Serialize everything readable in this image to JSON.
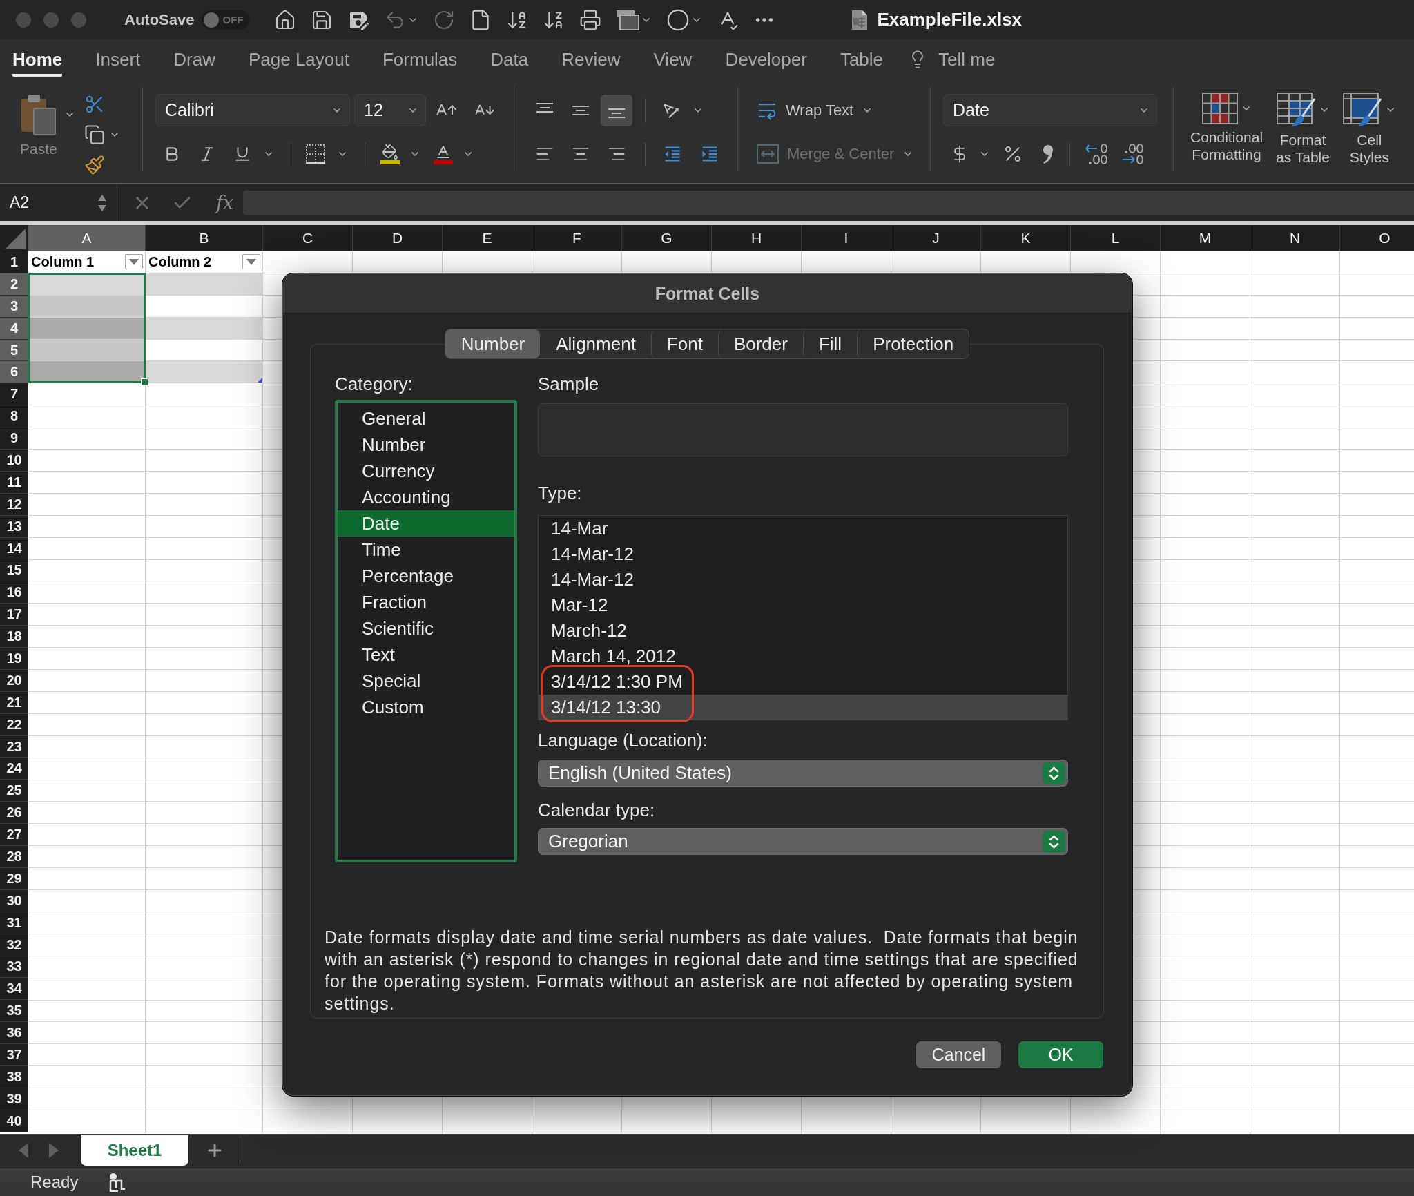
{
  "title_bar": {
    "autosave_label": "AutoSave",
    "autosave": {
      "on": false,
      "label": "OFF"
    },
    "filename": "ExampleFile.xlsx"
  },
  "ribbon_tabs": [
    {
      "label": "Home",
      "selected": true
    },
    {
      "label": "Insert",
      "selected": false
    },
    {
      "label": "Draw",
      "selected": false
    },
    {
      "label": "Page Layout",
      "selected": false
    },
    {
      "label": "Formulas",
      "selected": false
    },
    {
      "label": "Data",
      "selected": false
    },
    {
      "label": "Review",
      "selected": false
    },
    {
      "label": "View",
      "selected": false
    },
    {
      "label": "Developer",
      "selected": false
    },
    {
      "label": "Table",
      "selected": false
    }
  ],
  "tell_me": "Tell me",
  "ribbon": {
    "paste": "Paste",
    "font": "Calibri",
    "font_size": "12",
    "vertical_alignment": [
      {
        "kind": "top",
        "selected": false
      },
      {
        "kind": "middle",
        "selected": false
      },
      {
        "kind": "bottom",
        "selected": true
      }
    ],
    "wrap_text": "Wrap Text",
    "merge_center": {
      "label": "Merge & Center",
      "disabled": true
    },
    "number_format": "Date",
    "styles": [
      {
        "kind": "conditional",
        "lines": [
          "Conditional",
          "Formatting"
        ]
      },
      {
        "kind": "table",
        "lines": [
          "Format",
          "as Table"
        ]
      },
      {
        "kind": "cell",
        "lines": [
          "Cell",
          "Styles"
        ]
      }
    ]
  },
  "formula_bar": {
    "cell_reference": "A2",
    "function_label": "fx"
  },
  "sheet": {
    "columns": [
      {
        "label": "A",
        "selected": true
      },
      {
        "label": "B",
        "selected": false
      },
      {
        "label": "C",
        "selected": false
      },
      {
        "label": "D",
        "selected": false
      },
      {
        "label": "E",
        "selected": false
      },
      {
        "label": "F",
        "selected": false
      },
      {
        "label": "G",
        "selected": false
      },
      {
        "label": "H",
        "selected": false
      },
      {
        "label": "I",
        "selected": false
      },
      {
        "label": "J",
        "selected": false
      },
      {
        "label": "K",
        "selected": false
      },
      {
        "label": "L",
        "selected": false
      },
      {
        "label": "M",
        "selected": false
      },
      {
        "label": "N",
        "selected": false
      },
      {
        "label": "O",
        "selected": false
      }
    ],
    "rows": [
      {
        "label": "1",
        "selected": false,
        "in_table": true
      },
      {
        "label": "2",
        "selected": true,
        "in_table": true
      },
      {
        "label": "3",
        "selected": true,
        "in_table": true
      },
      {
        "label": "4",
        "selected": true,
        "in_table": true
      },
      {
        "label": "5",
        "selected": true,
        "in_table": true
      },
      {
        "label": "6",
        "selected": true,
        "in_table": true
      },
      {
        "label": "7",
        "selected": false,
        "in_table": false
      },
      {
        "label": "8",
        "selected": false,
        "in_table": false
      },
      {
        "label": "9",
        "selected": false,
        "in_table": false
      },
      {
        "label": "10",
        "selected": false,
        "in_table": false
      },
      {
        "label": "11",
        "selected": false,
        "in_table": false
      },
      {
        "label": "12",
        "selected": false,
        "in_table": false
      },
      {
        "label": "13",
        "selected": false,
        "in_table": false
      },
      {
        "label": "14",
        "selected": false,
        "in_table": false
      },
      {
        "label": "15",
        "selected": false,
        "in_table": false
      },
      {
        "label": "16",
        "selected": false,
        "in_table": false
      },
      {
        "label": "17",
        "selected": false,
        "in_table": false
      },
      {
        "label": "18",
        "selected": false,
        "in_table": false
      },
      {
        "label": "19",
        "selected": false,
        "in_table": false
      },
      {
        "label": "20",
        "selected": false,
        "in_table": false
      },
      {
        "label": "21",
        "selected": false,
        "in_table": false
      },
      {
        "label": "22",
        "selected": false,
        "in_table": false
      },
      {
        "label": "23",
        "selected": false,
        "in_table": false
      },
      {
        "label": "24",
        "selected": false,
        "in_table": false
      },
      {
        "label": "25",
        "selected": false,
        "in_table": false
      },
      {
        "label": "26",
        "selected": false,
        "in_table": false
      },
      {
        "label": "27",
        "selected": false,
        "in_table": false
      },
      {
        "label": "28",
        "selected": false,
        "in_table": false
      },
      {
        "label": "29",
        "selected": false,
        "in_table": false
      },
      {
        "label": "30",
        "selected": false,
        "in_table": false
      },
      {
        "label": "31",
        "selected": false,
        "in_table": false
      },
      {
        "label": "32",
        "selected": false,
        "in_table": false
      },
      {
        "label": "33",
        "selected": false,
        "in_table": false
      },
      {
        "label": "34",
        "selected": false,
        "in_table": false
      },
      {
        "label": "35",
        "selected": false,
        "in_table": false
      },
      {
        "label": "36",
        "selected": false,
        "in_table": false
      },
      {
        "label": "37",
        "selected": false,
        "in_table": false
      },
      {
        "label": "38",
        "selected": false,
        "in_table": false
      },
      {
        "label": "39",
        "selected": false,
        "in_table": false
      },
      {
        "label": "40",
        "selected": false,
        "in_table": false
      }
    ],
    "table_headers": [
      "Column 1",
      "Column 2"
    ]
  },
  "dialog": {
    "title": "Format Cells",
    "tabs": [
      {
        "label": "Number",
        "selected": true
      },
      {
        "label": "Alignment",
        "selected": false
      },
      {
        "label": "Font",
        "selected": false
      },
      {
        "label": "Border",
        "selected": false
      },
      {
        "label": "Fill",
        "selected": false
      },
      {
        "label": "Protection",
        "selected": false
      }
    ],
    "category_label": "Category:",
    "categories": [
      {
        "label": "General",
        "selected": false
      },
      {
        "label": "Number",
        "selected": false
      },
      {
        "label": "Currency",
        "selected": false
      },
      {
        "label": "Accounting",
        "selected": false
      },
      {
        "label": "Date",
        "selected": true
      },
      {
        "label": "Time",
        "selected": false
      },
      {
        "label": "Percentage",
        "selected": false
      },
      {
        "label": "Fraction",
        "selected": false
      },
      {
        "label": "Scientific",
        "selected": false
      },
      {
        "label": "Text",
        "selected": false
      },
      {
        "label": "Special",
        "selected": false
      },
      {
        "label": "Custom",
        "selected": false
      }
    ],
    "sample_label": "Sample",
    "type_label": "Type:",
    "types": [
      {
        "label": "14-Mar",
        "selected": false,
        "circled": false
      },
      {
        "label": "14-Mar-12",
        "selected": false,
        "circled": false
      },
      {
        "label": "14-Mar-12",
        "selected": false,
        "circled": false
      },
      {
        "label": "Mar-12",
        "selected": false,
        "circled": false
      },
      {
        "label": "March-12",
        "selected": false,
        "circled": false
      },
      {
        "label": "March 14, 2012",
        "selected": false,
        "circled": false
      },
      {
        "label": "3/14/12 1:30 PM",
        "selected": false,
        "circled": true
      },
      {
        "label": "3/14/12 13:30",
        "selected": true,
        "circled": true
      }
    ],
    "language_label": "Language (Location):",
    "language": "English (United States)",
    "calendar_label": "Calendar type:",
    "calendar": "Gregorian",
    "description": "Date formats display date and time serial numbers as date values.  Date formats that begin with an asterisk (*) respond to changes in regional date and time settings that are specified for the operating system. Formats without an asterisk are not affected by operating system settings.",
    "buttons": [
      {
        "label": "Cancel",
        "kind": "secondary"
      },
      {
        "label": "OK",
        "kind": "primary"
      }
    ]
  },
  "sheet_tabs": [
    {
      "label": "Sheet1",
      "selected": true
    }
  ],
  "status_bar": {
    "status": "Ready"
  }
}
